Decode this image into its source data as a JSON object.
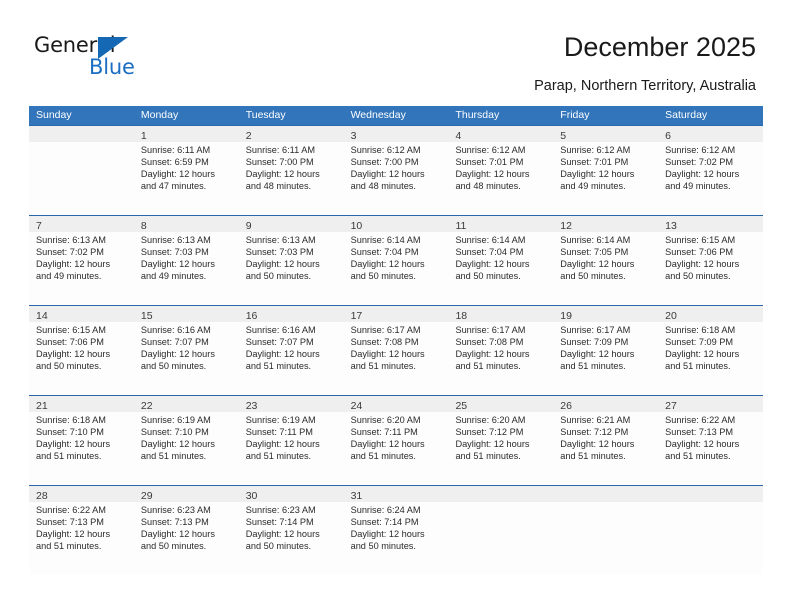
{
  "brand": {
    "name_part1": "General",
    "name_part2": "Blue"
  },
  "header": {
    "title": "December 2025",
    "location": "Parap, Northern Territory, Australia"
  },
  "colors": {
    "header_blue": "#3275bb",
    "row_separator": "#2a68ab",
    "day_band": "#efefef",
    "brand_blue": "#1b6ec2"
  },
  "calendar": {
    "weekdays": [
      "Sunday",
      "Monday",
      "Tuesday",
      "Wednesday",
      "Thursday",
      "Friday",
      "Saturday"
    ],
    "weeks": [
      [
        {
          "day": "",
          "sunrise": "",
          "sunset": "",
          "daylight_line1": "",
          "daylight_line2": ""
        },
        {
          "day": "1",
          "sunrise": "Sunrise: 6:11 AM",
          "sunset": "Sunset: 6:59 PM",
          "daylight_line1": "Daylight: 12 hours",
          "daylight_line2": "and 47 minutes."
        },
        {
          "day": "2",
          "sunrise": "Sunrise: 6:11 AM",
          "sunset": "Sunset: 7:00 PM",
          "daylight_line1": "Daylight: 12 hours",
          "daylight_line2": "and 48 minutes."
        },
        {
          "day": "3",
          "sunrise": "Sunrise: 6:12 AM",
          "sunset": "Sunset: 7:00 PM",
          "daylight_line1": "Daylight: 12 hours",
          "daylight_line2": "and 48 minutes."
        },
        {
          "day": "4",
          "sunrise": "Sunrise: 6:12 AM",
          "sunset": "Sunset: 7:01 PM",
          "daylight_line1": "Daylight: 12 hours",
          "daylight_line2": "and 48 minutes."
        },
        {
          "day": "5",
          "sunrise": "Sunrise: 6:12 AM",
          "sunset": "Sunset: 7:01 PM",
          "daylight_line1": "Daylight: 12 hours",
          "daylight_line2": "and 49 minutes."
        },
        {
          "day": "6",
          "sunrise": "Sunrise: 6:12 AM",
          "sunset": "Sunset: 7:02 PM",
          "daylight_line1": "Daylight: 12 hours",
          "daylight_line2": "and 49 minutes."
        }
      ],
      [
        {
          "day": "7",
          "sunrise": "Sunrise: 6:13 AM",
          "sunset": "Sunset: 7:02 PM",
          "daylight_line1": "Daylight: 12 hours",
          "daylight_line2": "and 49 minutes."
        },
        {
          "day": "8",
          "sunrise": "Sunrise: 6:13 AM",
          "sunset": "Sunset: 7:03 PM",
          "daylight_line1": "Daylight: 12 hours",
          "daylight_line2": "and 49 minutes."
        },
        {
          "day": "9",
          "sunrise": "Sunrise: 6:13 AM",
          "sunset": "Sunset: 7:03 PM",
          "daylight_line1": "Daylight: 12 hours",
          "daylight_line2": "and 50 minutes."
        },
        {
          "day": "10",
          "sunrise": "Sunrise: 6:14 AM",
          "sunset": "Sunset: 7:04 PM",
          "daylight_line1": "Daylight: 12 hours",
          "daylight_line2": "and 50 minutes."
        },
        {
          "day": "11",
          "sunrise": "Sunrise: 6:14 AM",
          "sunset": "Sunset: 7:04 PM",
          "daylight_line1": "Daylight: 12 hours",
          "daylight_line2": "and 50 minutes."
        },
        {
          "day": "12",
          "sunrise": "Sunrise: 6:14 AM",
          "sunset": "Sunset: 7:05 PM",
          "daylight_line1": "Daylight: 12 hours",
          "daylight_line2": "and 50 minutes."
        },
        {
          "day": "13",
          "sunrise": "Sunrise: 6:15 AM",
          "sunset": "Sunset: 7:06 PM",
          "daylight_line1": "Daylight: 12 hours",
          "daylight_line2": "and 50 minutes."
        }
      ],
      [
        {
          "day": "14",
          "sunrise": "Sunrise: 6:15 AM",
          "sunset": "Sunset: 7:06 PM",
          "daylight_line1": "Daylight: 12 hours",
          "daylight_line2": "and 50 minutes."
        },
        {
          "day": "15",
          "sunrise": "Sunrise: 6:16 AM",
          "sunset": "Sunset: 7:07 PM",
          "daylight_line1": "Daylight: 12 hours",
          "daylight_line2": "and 50 minutes."
        },
        {
          "day": "16",
          "sunrise": "Sunrise: 6:16 AM",
          "sunset": "Sunset: 7:07 PM",
          "daylight_line1": "Daylight: 12 hours",
          "daylight_line2": "and 51 minutes."
        },
        {
          "day": "17",
          "sunrise": "Sunrise: 6:17 AM",
          "sunset": "Sunset: 7:08 PM",
          "daylight_line1": "Daylight: 12 hours",
          "daylight_line2": "and 51 minutes."
        },
        {
          "day": "18",
          "sunrise": "Sunrise: 6:17 AM",
          "sunset": "Sunset: 7:08 PM",
          "daylight_line1": "Daylight: 12 hours",
          "daylight_line2": "and 51 minutes."
        },
        {
          "day": "19",
          "sunrise": "Sunrise: 6:17 AM",
          "sunset": "Sunset: 7:09 PM",
          "daylight_line1": "Daylight: 12 hours",
          "daylight_line2": "and 51 minutes."
        },
        {
          "day": "20",
          "sunrise": "Sunrise: 6:18 AM",
          "sunset": "Sunset: 7:09 PM",
          "daylight_line1": "Daylight: 12 hours",
          "daylight_line2": "and 51 minutes."
        }
      ],
      [
        {
          "day": "21",
          "sunrise": "Sunrise: 6:18 AM",
          "sunset": "Sunset: 7:10 PM",
          "daylight_line1": "Daylight: 12 hours",
          "daylight_line2": "and 51 minutes."
        },
        {
          "day": "22",
          "sunrise": "Sunrise: 6:19 AM",
          "sunset": "Sunset: 7:10 PM",
          "daylight_line1": "Daylight: 12 hours",
          "daylight_line2": "and 51 minutes."
        },
        {
          "day": "23",
          "sunrise": "Sunrise: 6:19 AM",
          "sunset": "Sunset: 7:11 PM",
          "daylight_line1": "Daylight: 12 hours",
          "daylight_line2": "and 51 minutes."
        },
        {
          "day": "24",
          "sunrise": "Sunrise: 6:20 AM",
          "sunset": "Sunset: 7:11 PM",
          "daylight_line1": "Daylight: 12 hours",
          "daylight_line2": "and 51 minutes."
        },
        {
          "day": "25",
          "sunrise": "Sunrise: 6:20 AM",
          "sunset": "Sunset: 7:12 PM",
          "daylight_line1": "Daylight: 12 hours",
          "daylight_line2": "and 51 minutes."
        },
        {
          "day": "26",
          "sunrise": "Sunrise: 6:21 AM",
          "sunset": "Sunset: 7:12 PM",
          "daylight_line1": "Daylight: 12 hours",
          "daylight_line2": "and 51 minutes."
        },
        {
          "day": "27",
          "sunrise": "Sunrise: 6:22 AM",
          "sunset": "Sunset: 7:13 PM",
          "daylight_line1": "Daylight: 12 hours",
          "daylight_line2": "and 51 minutes."
        }
      ],
      [
        {
          "day": "28",
          "sunrise": "Sunrise: 6:22 AM",
          "sunset": "Sunset: 7:13 PM",
          "daylight_line1": "Daylight: 12 hours",
          "daylight_line2": "and 51 minutes."
        },
        {
          "day": "29",
          "sunrise": "Sunrise: 6:23 AM",
          "sunset": "Sunset: 7:13 PM",
          "daylight_line1": "Daylight: 12 hours",
          "daylight_line2": "and 50 minutes."
        },
        {
          "day": "30",
          "sunrise": "Sunrise: 6:23 AM",
          "sunset": "Sunset: 7:14 PM",
          "daylight_line1": "Daylight: 12 hours",
          "daylight_line2": "and 50 minutes."
        },
        {
          "day": "31",
          "sunrise": "Sunrise: 6:24 AM",
          "sunset": "Sunset: 7:14 PM",
          "daylight_line1": "Daylight: 12 hours",
          "daylight_line2": "and 50 minutes."
        },
        {
          "day": "",
          "sunrise": "",
          "sunset": "",
          "daylight_line1": "",
          "daylight_line2": ""
        },
        {
          "day": "",
          "sunrise": "",
          "sunset": "",
          "daylight_line1": "",
          "daylight_line2": ""
        },
        {
          "day": "",
          "sunrise": "",
          "sunset": "",
          "daylight_line1": "",
          "daylight_line2": ""
        }
      ]
    ]
  }
}
